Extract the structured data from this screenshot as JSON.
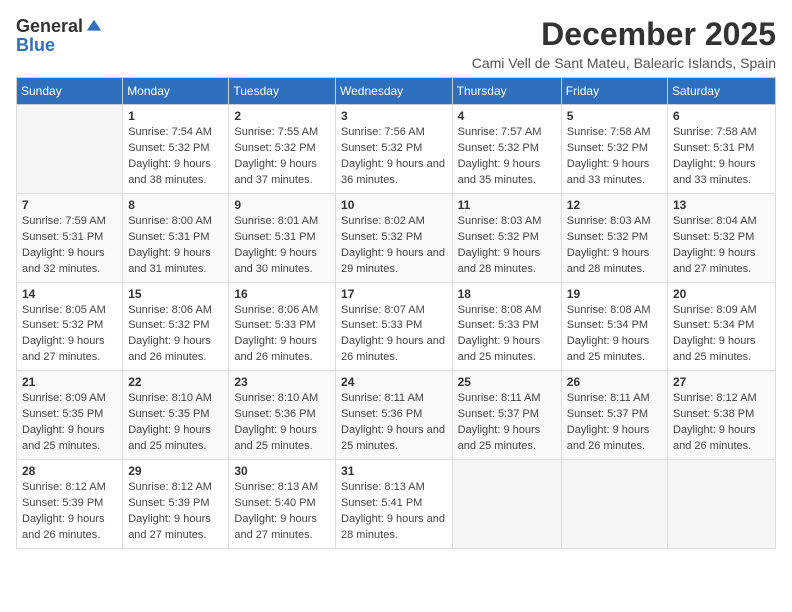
{
  "logo": {
    "general": "General",
    "blue": "Blue"
  },
  "title": "December 2025",
  "subtitle": "Cami Vell de Sant Mateu, Balearic Islands, Spain",
  "weekdays": [
    "Sunday",
    "Monday",
    "Tuesday",
    "Wednesday",
    "Thursday",
    "Friday",
    "Saturday"
  ],
  "weeks": [
    [
      {
        "day": "",
        "sunrise": "",
        "sunset": "",
        "daylight": ""
      },
      {
        "day": "1",
        "sunrise": "Sunrise: 7:54 AM",
        "sunset": "Sunset: 5:32 PM",
        "daylight": "Daylight: 9 hours and 38 minutes."
      },
      {
        "day": "2",
        "sunrise": "Sunrise: 7:55 AM",
        "sunset": "Sunset: 5:32 PM",
        "daylight": "Daylight: 9 hours and 37 minutes."
      },
      {
        "day": "3",
        "sunrise": "Sunrise: 7:56 AM",
        "sunset": "Sunset: 5:32 PM",
        "daylight": "Daylight: 9 hours and 36 minutes."
      },
      {
        "day": "4",
        "sunrise": "Sunrise: 7:57 AM",
        "sunset": "Sunset: 5:32 PM",
        "daylight": "Daylight: 9 hours and 35 minutes."
      },
      {
        "day": "5",
        "sunrise": "Sunrise: 7:58 AM",
        "sunset": "Sunset: 5:32 PM",
        "daylight": "Daylight: 9 hours and 33 minutes."
      },
      {
        "day": "6",
        "sunrise": "Sunrise: 7:58 AM",
        "sunset": "Sunset: 5:31 PM",
        "daylight": "Daylight: 9 hours and 33 minutes."
      }
    ],
    [
      {
        "day": "7",
        "sunrise": "Sunrise: 7:59 AM",
        "sunset": "Sunset: 5:31 PM",
        "daylight": "Daylight: 9 hours and 32 minutes."
      },
      {
        "day": "8",
        "sunrise": "Sunrise: 8:00 AM",
        "sunset": "Sunset: 5:31 PM",
        "daylight": "Daylight: 9 hours and 31 minutes."
      },
      {
        "day": "9",
        "sunrise": "Sunrise: 8:01 AM",
        "sunset": "Sunset: 5:31 PM",
        "daylight": "Daylight: 9 hours and 30 minutes."
      },
      {
        "day": "10",
        "sunrise": "Sunrise: 8:02 AM",
        "sunset": "Sunset: 5:32 PM",
        "daylight": "Daylight: 9 hours and 29 minutes."
      },
      {
        "day": "11",
        "sunrise": "Sunrise: 8:03 AM",
        "sunset": "Sunset: 5:32 PM",
        "daylight": "Daylight: 9 hours and 28 minutes."
      },
      {
        "day": "12",
        "sunrise": "Sunrise: 8:03 AM",
        "sunset": "Sunset: 5:32 PM",
        "daylight": "Daylight: 9 hours and 28 minutes."
      },
      {
        "day": "13",
        "sunrise": "Sunrise: 8:04 AM",
        "sunset": "Sunset: 5:32 PM",
        "daylight": "Daylight: 9 hours and 27 minutes."
      }
    ],
    [
      {
        "day": "14",
        "sunrise": "Sunrise: 8:05 AM",
        "sunset": "Sunset: 5:32 PM",
        "daylight": "Daylight: 9 hours and 27 minutes."
      },
      {
        "day": "15",
        "sunrise": "Sunrise: 8:06 AM",
        "sunset": "Sunset: 5:32 PM",
        "daylight": "Daylight: 9 hours and 26 minutes."
      },
      {
        "day": "16",
        "sunrise": "Sunrise: 8:06 AM",
        "sunset": "Sunset: 5:33 PM",
        "daylight": "Daylight: 9 hours and 26 minutes."
      },
      {
        "day": "17",
        "sunrise": "Sunrise: 8:07 AM",
        "sunset": "Sunset: 5:33 PM",
        "daylight": "Daylight: 9 hours and 26 minutes."
      },
      {
        "day": "18",
        "sunrise": "Sunrise: 8:08 AM",
        "sunset": "Sunset: 5:33 PM",
        "daylight": "Daylight: 9 hours and 25 minutes."
      },
      {
        "day": "19",
        "sunrise": "Sunrise: 8:08 AM",
        "sunset": "Sunset: 5:34 PM",
        "daylight": "Daylight: 9 hours and 25 minutes."
      },
      {
        "day": "20",
        "sunrise": "Sunrise: 8:09 AM",
        "sunset": "Sunset: 5:34 PM",
        "daylight": "Daylight: 9 hours and 25 minutes."
      }
    ],
    [
      {
        "day": "21",
        "sunrise": "Sunrise: 8:09 AM",
        "sunset": "Sunset: 5:35 PM",
        "daylight": "Daylight: 9 hours and 25 minutes."
      },
      {
        "day": "22",
        "sunrise": "Sunrise: 8:10 AM",
        "sunset": "Sunset: 5:35 PM",
        "daylight": "Daylight: 9 hours and 25 minutes."
      },
      {
        "day": "23",
        "sunrise": "Sunrise: 8:10 AM",
        "sunset": "Sunset: 5:36 PM",
        "daylight": "Daylight: 9 hours and 25 minutes."
      },
      {
        "day": "24",
        "sunrise": "Sunrise: 8:11 AM",
        "sunset": "Sunset: 5:36 PM",
        "daylight": "Daylight: 9 hours and 25 minutes."
      },
      {
        "day": "25",
        "sunrise": "Sunrise: 8:11 AM",
        "sunset": "Sunset: 5:37 PM",
        "daylight": "Daylight: 9 hours and 25 minutes."
      },
      {
        "day": "26",
        "sunrise": "Sunrise: 8:11 AM",
        "sunset": "Sunset: 5:37 PM",
        "daylight": "Daylight: 9 hours and 26 minutes."
      },
      {
        "day": "27",
        "sunrise": "Sunrise: 8:12 AM",
        "sunset": "Sunset: 5:38 PM",
        "daylight": "Daylight: 9 hours and 26 minutes."
      }
    ],
    [
      {
        "day": "28",
        "sunrise": "Sunrise: 8:12 AM",
        "sunset": "Sunset: 5:39 PM",
        "daylight": "Daylight: 9 hours and 26 minutes."
      },
      {
        "day": "29",
        "sunrise": "Sunrise: 8:12 AM",
        "sunset": "Sunset: 5:39 PM",
        "daylight": "Daylight: 9 hours and 27 minutes."
      },
      {
        "day": "30",
        "sunrise": "Sunrise: 8:13 AM",
        "sunset": "Sunset: 5:40 PM",
        "daylight": "Daylight: 9 hours and 27 minutes."
      },
      {
        "day": "31",
        "sunrise": "Sunrise: 8:13 AM",
        "sunset": "Sunset: 5:41 PM",
        "daylight": "Daylight: 9 hours and 28 minutes."
      },
      {
        "day": "",
        "sunrise": "",
        "sunset": "",
        "daylight": ""
      },
      {
        "day": "",
        "sunrise": "",
        "sunset": "",
        "daylight": ""
      },
      {
        "day": "",
        "sunrise": "",
        "sunset": "",
        "daylight": ""
      }
    ]
  ]
}
